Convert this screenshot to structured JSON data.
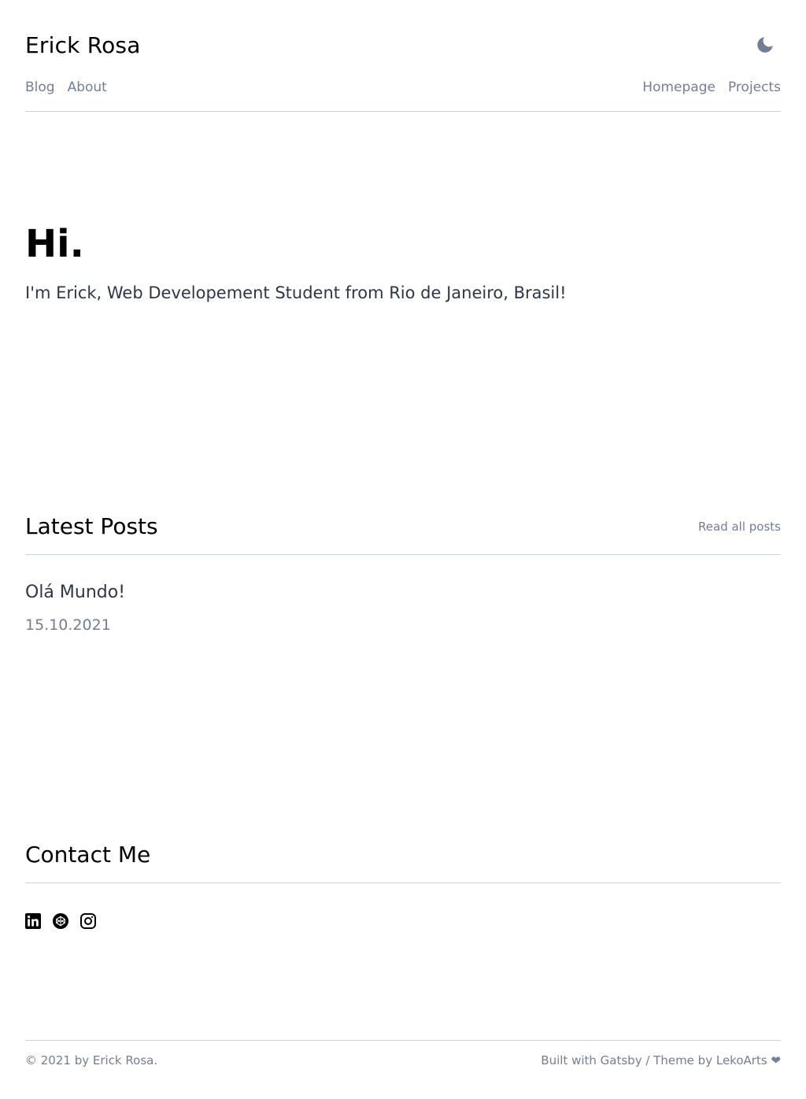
{
  "header": {
    "site_title": "Erick Rosa",
    "theme_toggle_icon": "moon-icon",
    "nav_left": [
      {
        "label": "Blog"
      },
      {
        "label": "About"
      }
    ],
    "nav_right": [
      {
        "label": "Homepage"
      },
      {
        "label": "Projects"
      }
    ]
  },
  "hero": {
    "title": "Hi.",
    "subtitle": "I'm Erick, Web Developement Student from Rio de Janeiro, Brasil!"
  },
  "latest_posts": {
    "title": "Latest Posts",
    "read_all": "Read all posts",
    "posts": [
      {
        "title": "Olá Mundo!",
        "date": "15.10.2021"
      }
    ]
  },
  "contact": {
    "title": "Contact Me",
    "icons": [
      "linkedin-icon",
      "codepen-icon",
      "instagram-icon"
    ]
  },
  "footer": {
    "copyright": "© 2021 by Erick Rosa.",
    "built_prefix": "Built with ",
    "gatsby": "Gatsby",
    "separator": " / ",
    "theme_prefix": "Theme by ",
    "lekoarts": "LekoArts",
    "heart": "❤"
  },
  "colors": {
    "muted": "#718096",
    "rule": "#cbd5e0",
    "text": "#2d3748",
    "heading": "#000000"
  }
}
